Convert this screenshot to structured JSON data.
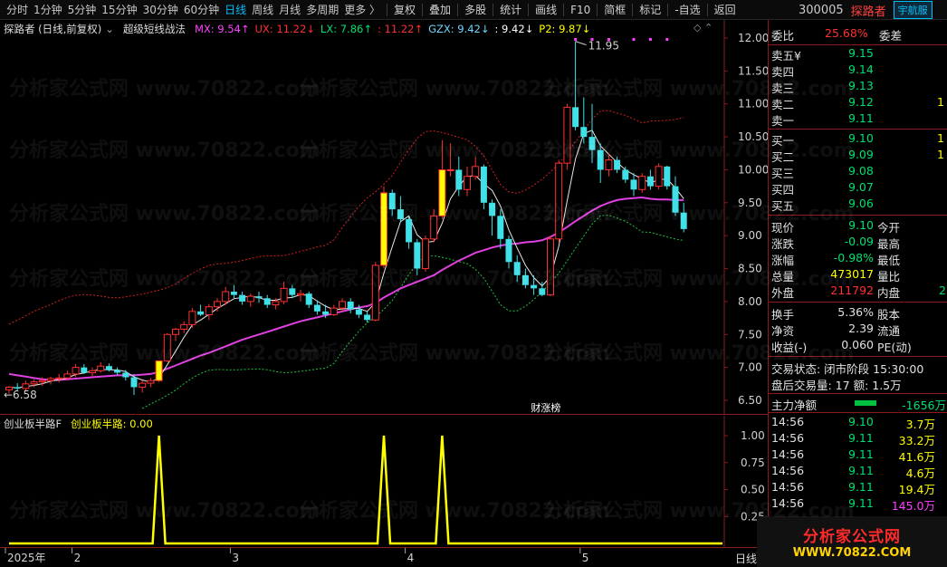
{
  "toolbar": {
    "periods": [
      "分时",
      "1分钟",
      "5分钟",
      "15分钟",
      "30分钟",
      "60分钟",
      "日线",
      "周线",
      "月线",
      "多周期",
      "更多 〉"
    ],
    "active_period": "日线",
    "tools": [
      "复权",
      "叠加",
      "多股",
      "统计",
      "画线",
      "F10",
      "简框",
      "标记",
      "-自选",
      "返回"
    ]
  },
  "stock": {
    "code": "300005",
    "name": "探路者",
    "nav_badge": "宇航服"
  },
  "main_legend": {
    "title": "探路者 (日线,前复权)",
    "indicator": "超级短线战法",
    "items": [
      {
        "text": "MX: 9.54↑",
        "color": "#ff40ff"
      },
      {
        "text": "UX: 11.22↓",
        "color": "#ff3030"
      },
      {
        "text": "LX: 7.86↑",
        "color": "#00e070"
      },
      {
        "text": ": 11.22↑",
        "color": "#ff3030"
      },
      {
        "text": "GZX: 9.42↓",
        "color": "#6fd6ff"
      },
      {
        "text": ": 9.42↓",
        "color": "#ffffff"
      },
      {
        "text": "P2: 9.87↓",
        "color": "#ffff00"
      }
    ]
  },
  "sub_legend": {
    "title": "创业板半路F",
    "item": "创业板半路: 0.00"
  },
  "price_axis": [
    "12.00",
    "11.50",
    "11.00",
    "10.50",
    "10.00",
    "9.50",
    "9.00",
    "8.50",
    "8.00",
    "7.50",
    "7.00",
    "6.50"
  ],
  "sub_axis": [
    "1.00",
    "0.75",
    "0.50",
    "0.25"
  ],
  "annotations": {
    "high": "11.95",
    "low": "6.58",
    "event": "财涨榜"
  },
  "date_axis": [
    {
      "label": "2025年",
      "pos": 0
    },
    {
      "label": "2",
      "pos": 1
    },
    {
      "label": "3",
      "pos": 2
    },
    {
      "label": "4",
      "pos": 3
    },
    {
      "label": "5",
      "pos": 4
    }
  ],
  "bottom_label": "日线",
  "order_book": {
    "weibi_label": "委比",
    "weibi": "25.68%",
    "weicha_label": "委差",
    "asks": [
      {
        "label": "卖五¥",
        "price": "9.15"
      },
      {
        "label": "卖四",
        "price": "9.14"
      },
      {
        "label": "卖三",
        "price": "9.13"
      },
      {
        "label": "卖二",
        "price": "9.12",
        "vol": "1"
      },
      {
        "label": "卖一",
        "price": "9.11"
      }
    ],
    "bids": [
      {
        "label": "买一",
        "price": "9.10",
        "vol": "1"
      },
      {
        "label": "买二",
        "price": "9.09",
        "vol": "1"
      },
      {
        "label": "买三",
        "price": "9.08"
      },
      {
        "label": "买四",
        "price": "9.07"
      },
      {
        "label": "买五",
        "price": "9.06"
      }
    ]
  },
  "quote": [
    {
      "l": "现价",
      "v": "9.10",
      "vc": "green",
      "r": "今开"
    },
    {
      "l": "涨跌",
      "v": "-0.09",
      "vc": "green",
      "r": "最高"
    },
    {
      "l": "涨幅",
      "v": "-0.98%",
      "vc": "green",
      "r": "最低"
    },
    {
      "l": "总量",
      "v": "473017",
      "vc": "yel",
      "r": "量比"
    },
    {
      "l": "外盘",
      "v": "211792",
      "vc": "red",
      "r": "内盘",
      "rv": "2"
    }
  ],
  "quote2": [
    {
      "l": "换手",
      "v": "5.36%",
      "r": "股本"
    },
    {
      "l": "净资",
      "v": "2.39",
      "r": "流通"
    },
    {
      "l": "收益(-)",
      "v": "0.060",
      "r": "PE(动)"
    }
  ],
  "status": {
    "line1": "交易状态: 闭市阶段 15:30:00",
    "line2": "盘后交易量: 17  额: 1.5万"
  },
  "net_flow": {
    "label": "主力净额",
    "value": "-1656万"
  },
  "ticks": [
    {
      "t": "14:56",
      "p": "9.10",
      "v": "3.7万",
      "vc": "yel"
    },
    {
      "t": "14:56",
      "p": "9.11",
      "v": "33.2万",
      "vc": "yel"
    },
    {
      "t": "14:56",
      "p": "9.11",
      "v": "41.6万",
      "vc": "yel"
    },
    {
      "t": "14:56",
      "p": "9.11",
      "v": "4.6万",
      "vc": "yel"
    },
    {
      "t": "14:56",
      "p": "9.11",
      "v": "19.4万",
      "vc": "yel"
    },
    {
      "t": "14:56",
      "p": "9.11",
      "v": "145.0万",
      "vc": "mag"
    }
  ],
  "watermark": {
    "line1": "分析家公式网",
    "line2": "WWW.70822.COM",
    "bg": "分析家公式网 www.70822.com"
  },
  "chart_data": {
    "type": "candlestick",
    "ylim": [
      6.5,
      12.0
    ],
    "sub_ylim": [
      0,
      1.0
    ],
    "candles": [
      [
        6.66,
        6.72,
        6.6,
        6.7
      ],
      [
        6.7,
        6.76,
        6.65,
        6.68
      ],
      [
        6.68,
        6.8,
        6.64,
        6.75
      ],
      [
        6.75,
        6.82,
        6.7,
        6.78
      ],
      [
        6.78,
        6.85,
        6.72,
        6.8
      ],
      [
        6.8,
        6.86,
        6.74,
        6.83
      ],
      [
        6.83,
        6.9,
        6.77,
        6.84
      ],
      [
        6.84,
        6.95,
        6.8,
        6.9
      ],
      [
        6.9,
        7.05,
        6.85,
        7.0
      ],
      [
        7.0,
        7.05,
        6.9,
        6.92
      ],
      [
        6.92,
        7.0,
        6.86,
        6.95
      ],
      [
        6.95,
        7.08,
        6.92,
        7.02
      ],
      [
        7.02,
        7.06,
        6.94,
        6.96
      ],
      [
        6.96,
        7.0,
        6.88,
        6.92
      ],
      [
        6.92,
        6.96,
        6.8,
        6.85
      ],
      [
        6.85,
        6.9,
        6.58,
        6.7
      ],
      [
        6.7,
        6.8,
        6.62,
        6.76
      ],
      [
        6.76,
        6.84,
        6.7,
        6.8
      ],
      [
        6.8,
        7.1,
        6.78,
        7.1
      ],
      [
        7.1,
        7.52,
        7.08,
        7.5
      ],
      [
        7.5,
        7.6,
        7.4,
        7.58
      ],
      [
        7.58,
        7.7,
        7.52,
        7.65
      ],
      [
        7.65,
        7.9,
        7.6,
        7.85
      ],
      [
        7.85,
        7.95,
        7.78,
        7.8
      ],
      [
        7.8,
        7.96,
        7.72,
        7.92
      ],
      [
        7.92,
        8.05,
        7.85,
        8.0
      ],
      [
        8.0,
        8.22,
        7.95,
        8.15
      ],
      [
        8.15,
        8.25,
        8.05,
        8.1
      ],
      [
        8.1,
        8.15,
        7.95,
        8.0
      ],
      [
        8.0,
        8.12,
        7.92,
        8.08
      ],
      [
        8.08,
        8.15,
        7.98,
        8.05
      ],
      [
        8.05,
        8.1,
        7.9,
        7.95
      ],
      [
        7.95,
        8.05,
        7.88,
        8.0
      ],
      [
        8.0,
        8.3,
        7.96,
        8.2
      ],
      [
        8.2,
        8.25,
        8.05,
        8.1
      ],
      [
        8.1,
        8.18,
        8.0,
        8.12
      ],
      [
        8.12,
        8.15,
        7.9,
        7.95
      ],
      [
        7.95,
        8.02,
        7.8,
        7.85
      ],
      [
        7.85,
        7.95,
        7.75,
        7.8
      ],
      [
        7.8,
        7.95,
        7.78,
        7.9
      ],
      [
        7.9,
        8.05,
        7.85,
        8.0
      ],
      [
        8.0,
        8.05,
        7.82,
        7.88
      ],
      [
        7.88,
        7.95,
        7.75,
        7.8
      ],
      [
        7.8,
        7.85,
        7.68,
        7.72
      ],
      [
        7.72,
        8.6,
        7.7,
        8.55
      ],
      [
        8.55,
        9.75,
        8.5,
        9.65
      ],
      [
        9.65,
        9.7,
        9.3,
        9.4
      ],
      [
        9.4,
        9.6,
        9.2,
        9.25
      ],
      [
        9.25,
        9.3,
        8.8,
        8.9
      ],
      [
        8.9,
        8.95,
        8.4,
        8.5
      ],
      [
        8.5,
        9.0,
        8.45,
        8.95
      ],
      [
        8.95,
        9.4,
        8.9,
        9.3
      ],
      [
        9.3,
        10.45,
        9.25,
        10.0
      ],
      [
        10.0,
        10.4,
        9.9,
        10.0
      ],
      [
        10.0,
        10.2,
        9.6,
        9.7
      ],
      [
        9.7,
        10.05,
        9.6,
        9.9
      ],
      [
        9.9,
        10.2,
        9.85,
        10.05
      ],
      [
        10.05,
        10.08,
        9.4,
        9.5
      ],
      [
        9.5,
        9.55,
        9.0,
        9.3
      ],
      [
        9.3,
        9.4,
        8.8,
        8.95
      ],
      [
        8.95,
        9.0,
        8.5,
        8.6
      ],
      [
        8.6,
        8.7,
        8.3,
        8.4
      ],
      [
        8.4,
        8.5,
        8.2,
        8.25
      ],
      [
        8.25,
        8.4,
        8.1,
        8.2
      ],
      [
        8.2,
        8.3,
        8.08,
        8.1
      ],
      [
        8.1,
        9.0,
        8.08,
        8.95
      ],
      [
        8.95,
        10.15,
        8.9,
        10.1
      ],
      [
        10.1,
        11.0,
        10.0,
        10.95
      ],
      [
        10.95,
        11.95,
        10.6,
        10.65
      ],
      [
        10.65,
        11.1,
        10.4,
        10.5
      ],
      [
        10.5,
        11.0,
        10.1,
        10.3
      ],
      [
        10.3,
        10.4,
        9.8,
        10.0
      ],
      [
        10.0,
        10.25,
        9.9,
        10.15
      ],
      [
        10.15,
        10.2,
        9.95,
        10.0
      ],
      [
        10.0,
        10.05,
        9.8,
        9.85
      ],
      [
        9.85,
        9.95,
        9.6,
        9.7
      ],
      [
        9.7,
        9.95,
        9.65,
        9.9
      ],
      [
        9.9,
        10.0,
        9.7,
        9.75
      ],
      [
        9.75,
        10.1,
        9.7,
        10.05
      ],
      [
        10.05,
        10.06,
        9.7,
        9.75
      ],
      [
        9.75,
        9.9,
        9.3,
        9.35
      ],
      [
        9.35,
        9.5,
        9.05,
        9.1
      ]
    ],
    "ma": [
      6.9,
      6.88,
      6.86,
      6.84,
      6.82,
      6.81,
      6.81,
      6.82,
      6.83,
      6.84,
      6.85,
      6.86,
      6.87,
      6.88,
      6.88,
      6.88,
      6.89,
      6.9,
      6.93,
      6.98,
      7.03,
      7.08,
      7.13,
      7.18,
      7.22,
      7.27,
      7.32,
      7.37,
      7.42,
      7.46,
      7.5,
      7.54,
      7.58,
      7.62,
      7.66,
      7.7,
      7.73,
      7.76,
      7.79,
      7.82,
      7.85,
      7.88,
      7.91,
      7.93,
      7.98,
      8.06,
      8.13,
      8.2,
      8.25,
      8.3,
      8.35,
      8.4,
      8.48,
      8.55,
      8.62,
      8.68,
      8.74,
      8.78,
      8.82,
      8.85,
      8.87,
      8.88,
      8.9,
      8.91,
      8.93,
      8.98,
      9.05,
      9.13,
      9.22,
      9.3,
      9.38,
      9.45,
      9.5,
      9.54,
      9.56,
      9.57,
      9.58,
      9.56,
      9.55,
      9.55,
      9.54,
      9.54
    ],
    "signal_x": [
      18,
      45,
      52
    ],
    "event_x": 62
  }
}
